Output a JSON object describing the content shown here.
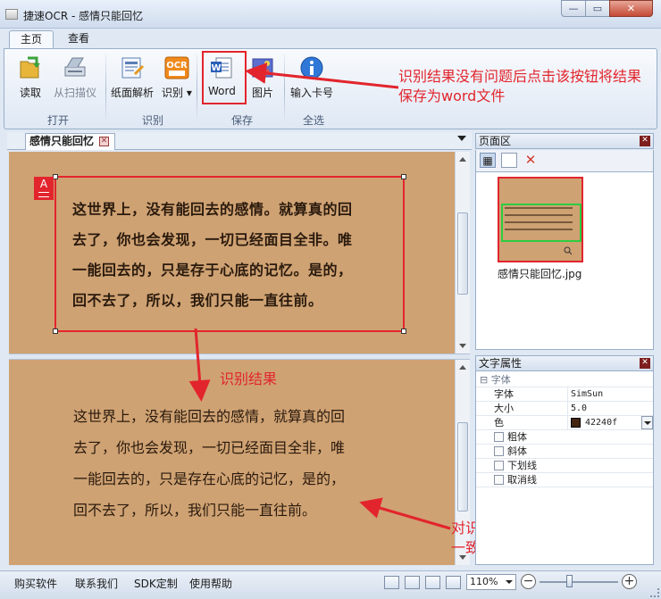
{
  "window": {
    "title": "捷速OCR - 感情只能回忆"
  },
  "ribbon": {
    "tabs": [
      {
        "label": "主页"
      },
      {
        "label": "查看"
      }
    ],
    "buttons": {
      "read": "读取",
      "scanner": "从扫描仪",
      "layout_parse": "纸面解析",
      "recognize": "识别",
      "word": "Word",
      "picture": "图片",
      "serial": "输入卡号"
    },
    "groups": {
      "open": "打开",
      "recognize": "识别",
      "save": "保存",
      "select_all": "全选"
    }
  },
  "annotations": {
    "word_tip": "识别结果没有问题后点击该按钮将结果保存为word文件",
    "result_tip": "识别结果",
    "verify_tip": "对识别结果进行核验，查看是否一致"
  },
  "document": {
    "tab_label": "感情只能回忆",
    "source_lines": [
      "这世界上，没有能回去的感情。就算真的回",
      "去了，你也会发现，一切已经面目全非。唯",
      "一能回去的，只是存于心底的记忆。是的，",
      "回不去了，所以，我们只能一直往前。"
    ],
    "result_lines": [
      "这世界上，没有能回去的感情，就算真的回",
      "去了，你也会发现，一切已经面目全非，唯",
      "一能回去的，只是存在心底的记忆，是的，",
      "回不去了，所以，我们只能一直往前。"
    ]
  },
  "page_panel": {
    "title": "页面区",
    "thumbnail_name": "感情只能回忆.jpg"
  },
  "text_props": {
    "title": "文字属性",
    "category": "字体",
    "rows": [
      {
        "key": "字体",
        "value": "SimSun"
      },
      {
        "key": "大小",
        "value": "5.0"
      },
      {
        "key": "色",
        "value": "42240f"
      }
    ],
    "checkboxes": [
      "粗体",
      "斜体",
      "下划线",
      "取消线"
    ]
  },
  "status": {
    "links": [
      "购买软件",
      "联系我们",
      "SDK定制",
      "使用帮助"
    ],
    "zoom": "110%"
  },
  "colors": {
    "accent_red": "#e2252d",
    "paper": "#cfa273",
    "text_color": "#42240f",
    "selection_green": "#2ecc40"
  }
}
